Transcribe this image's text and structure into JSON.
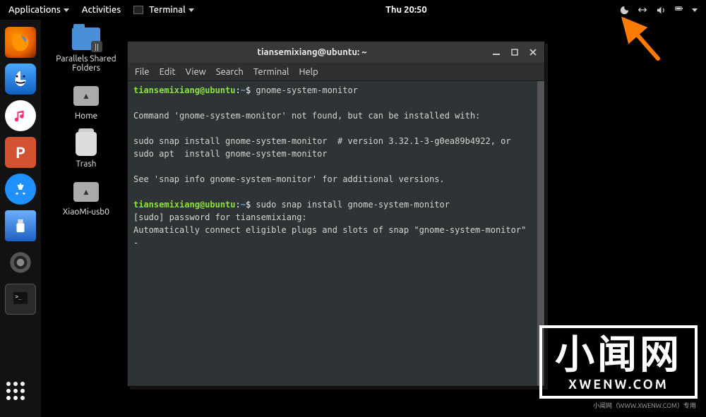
{
  "topbar": {
    "applications": "Applications",
    "activities": "Activities",
    "terminal": "Terminal",
    "clock": "Thu 20:50"
  },
  "desktop_icons": [
    {
      "label": "Parallels Shared Folders",
      "icon": "folder"
    },
    {
      "label": "Home",
      "icon": "disk"
    },
    {
      "label": "Trash",
      "icon": "trash"
    },
    {
      "label": "XiaoMi-usb0",
      "icon": "disk"
    }
  ],
  "terminal": {
    "title": "tiansemixiang@ubuntu: ~",
    "menu": [
      "File",
      "Edit",
      "View",
      "Search",
      "Terminal",
      "Help"
    ],
    "prompt_user": "tiansemixiang@ubuntu",
    "prompt_path": "~",
    "lines": [
      {
        "type": "cmd",
        "text": "gnome-system-monitor"
      },
      {
        "type": "blank"
      },
      {
        "type": "out",
        "text": "Command 'gnome-system-monitor' not found, but can be installed with:"
      },
      {
        "type": "blank"
      },
      {
        "type": "out",
        "text": "sudo snap install gnome-system-monitor  # version 3.32.1-3-g0ea89b4922, or"
      },
      {
        "type": "out",
        "text": "sudo apt  install gnome-system-monitor"
      },
      {
        "type": "blank"
      },
      {
        "type": "out",
        "text": "See 'snap info gnome-system-monitor' for additional versions."
      },
      {
        "type": "blank"
      },
      {
        "type": "cmd",
        "text": "sudo snap install gnome-system-monitor"
      },
      {
        "type": "out",
        "text": "[sudo] password for tiansemixiang:"
      },
      {
        "type": "out",
        "text": "Automatically connect eligible plugs and slots of snap \"gnome-system-monitor\"  -"
      }
    ]
  },
  "watermark": {
    "cn": "小闻网",
    "en": "XWENW.COM",
    "sub": "小闻网（WWW.XWENW.COM）专用"
  }
}
